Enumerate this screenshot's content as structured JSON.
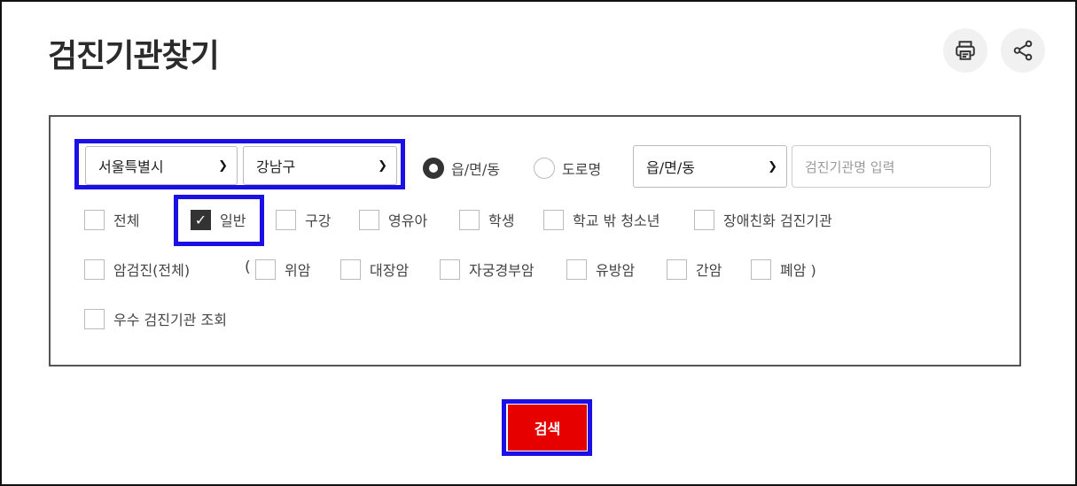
{
  "page": {
    "title": "검진기관찾기"
  },
  "toolbar": {
    "print_icon": "printer-icon",
    "share_icon": "share-icon"
  },
  "filters": {
    "city_select": "서울특별시",
    "district_select": "강남구",
    "radio_options": [
      {
        "label": "읍/면/동",
        "selected": true
      },
      {
        "label": "도로명",
        "selected": false
      }
    ],
    "area_select": "읍/면/동",
    "name_input": {
      "value": "",
      "placeholder": "검진기관명 입력"
    },
    "type_checkboxes": [
      {
        "label": "전체",
        "checked": false
      },
      {
        "label": "일반",
        "checked": true
      },
      {
        "label": "구강",
        "checked": false
      },
      {
        "label": "영유아",
        "checked": false
      },
      {
        "label": "학생",
        "checked": false
      },
      {
        "label": "학교 밖 청소년",
        "checked": false
      },
      {
        "label": "장애친화 검진기관",
        "checked": false
      }
    ],
    "cancer_all": {
      "label": "암검진(전체)",
      "checked": false
    },
    "paren_open": "(",
    "cancer_checkboxes": [
      {
        "label": "위암",
        "checked": false
      },
      {
        "label": "대장암",
        "checked": false
      },
      {
        "label": "자궁경부암",
        "checked": false
      },
      {
        "label": "유방암",
        "checked": false
      },
      {
        "label": "간암",
        "checked": false
      },
      {
        "label": "폐암 )",
        "checked": false
      }
    ],
    "excellent": {
      "label": "우수 검진기관 조회",
      "checked": false
    }
  },
  "actions": {
    "search_label": "검색"
  },
  "colors": {
    "highlight": "#1a10e6",
    "search_button": "#e60000"
  }
}
